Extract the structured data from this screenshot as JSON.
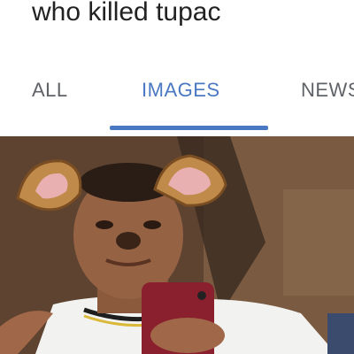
{
  "search": {
    "query": "who killed tupac"
  },
  "tabs": [
    {
      "label": "ALL",
      "selected": false
    },
    {
      "label": "IMAGES",
      "selected": true
    },
    {
      "label": "NEWS",
      "selected": false
    }
  ],
  "colors": {
    "accent": "#4a78c2",
    "tab_text": "#5f6368",
    "query_text": "#222222"
  },
  "image_result": {
    "icon": "photo-selfie-with-dog-ear-filter"
  }
}
